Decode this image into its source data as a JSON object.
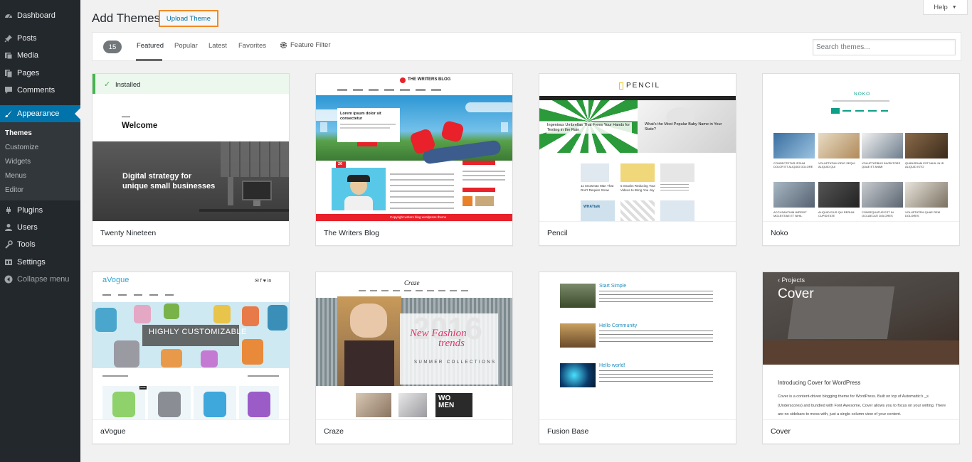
{
  "sidebar": {
    "items": [
      {
        "label": "Dashboard",
        "icon": "dashboard-icon"
      },
      {
        "label": "Posts",
        "icon": "pin-icon"
      },
      {
        "label": "Media",
        "icon": "media-icon"
      },
      {
        "label": "Pages",
        "icon": "pages-icon"
      },
      {
        "label": "Comments",
        "icon": "comments-icon"
      },
      {
        "label": "Appearance",
        "icon": "brush-icon"
      },
      {
        "label": "Plugins",
        "icon": "plugin-icon"
      },
      {
        "label": "Users",
        "icon": "users-icon"
      },
      {
        "label": "Tools",
        "icon": "wrench-icon"
      },
      {
        "label": "Settings",
        "icon": "settings-icon"
      }
    ],
    "submenu": [
      "Themes",
      "Customize",
      "Widgets",
      "Menus",
      "Editor"
    ],
    "collapse_label": "Collapse menu"
  },
  "page": {
    "title": "Add Themes",
    "upload_button": "Upload Theme",
    "help": "Help"
  },
  "filter": {
    "count": "15",
    "tabs": [
      "Featured",
      "Popular",
      "Latest",
      "Favorites"
    ],
    "active_tab": "Featured",
    "feature_filter": "Feature Filter",
    "search_placeholder": "Search themes..."
  },
  "themes": [
    {
      "name": "Twenty Nineteen",
      "installed": "Installed",
      "preview": {
        "heading": "Welcome",
        "headline_1": "Digital strategy for",
        "headline_2": "unique small businesses"
      }
    },
    {
      "name": "The Writers Blog",
      "preview": {
        "brand": "THE WRITERS BLOG",
        "slide_title": "Lorem ipsum dolor sit consectetur",
        "date_d": "26",
        "date_m": "JUL",
        "footer": "Copyright writers blog wordpress theme"
      }
    },
    {
      "name": "Pencil",
      "preview": {
        "brand": "PENCIL",
        "cap_1": "Ingenious Umbrellas That Frees Your Hands for Texting in the Rain",
        "cap_2": "What's the Most Popular Baby Name in Your State?",
        "card_1": "11 Snowman Man That Don't Require Snow",
        "card_2": "5 Snacks Reducing Your Videos to Bring You Joy",
        "logo_text": "WHATtalk"
      }
    },
    {
      "name": "Noko",
      "preview": {
        "brand": "NOKO",
        "captions": [
          "CONSECTETUR IPSUM DOLOR ET ALIQUID DOLORE",
          "VOLUPTATUM ODIO SEQUI ALIQUID QUI",
          "VOLUPTATIBUS INVENTORE QUAE ET ANIMI",
          "QUIBUSDAM EST NIHIL IN ID ALIQUID ISTO",
          "ACCUSANTIUM IMPEDIT MOLESTIAE ET NIHIL",
          "ALIQUID EIUS QUI RERUM CUPIDITATE",
          "CONSEQUATUR EST IN OCCAECATI DOLORES",
          "VOLUPTATEM QUAE REM DOLORES"
        ]
      }
    },
    {
      "name": "aVogue",
      "preview": {
        "brand": "aVogue",
        "banner": "HIGHLY CUSTOMIZABLE",
        "badge": "SALE"
      }
    },
    {
      "name": "Craze",
      "preview": {
        "brand": "Craze",
        "big_year": "2016",
        "script_1": "New Fashion",
        "script_2": "trends",
        "sub": "SUMMER COLLECTIONS",
        "women_1": "WO",
        "women_2": "MEN"
      }
    },
    {
      "name": "Fusion Base",
      "preview": {
        "posts": [
          "Start Simple",
          "Hello Community",
          "Hello world!"
        ]
      }
    },
    {
      "name": "Cover",
      "preview": {
        "back": "‹ Projects",
        "hero": "Cover",
        "intro": "Introducing Cover for WordPress",
        "body_1": "Cover is a content-driven blogging theme for WordPress. Built on top of Automattic's _s",
        "body_2": "(Underscores) and bundled with Font Awesome, Cover allows you to focus on your writing. There",
        "body_3": "are no sidebars to mess with, just a single column view of your content."
      }
    }
  ],
  "colors": {
    "sidebar": "#23282d",
    "accent": "#0073aa",
    "highlight": "#f08a24",
    "installed": "#46b450"
  }
}
